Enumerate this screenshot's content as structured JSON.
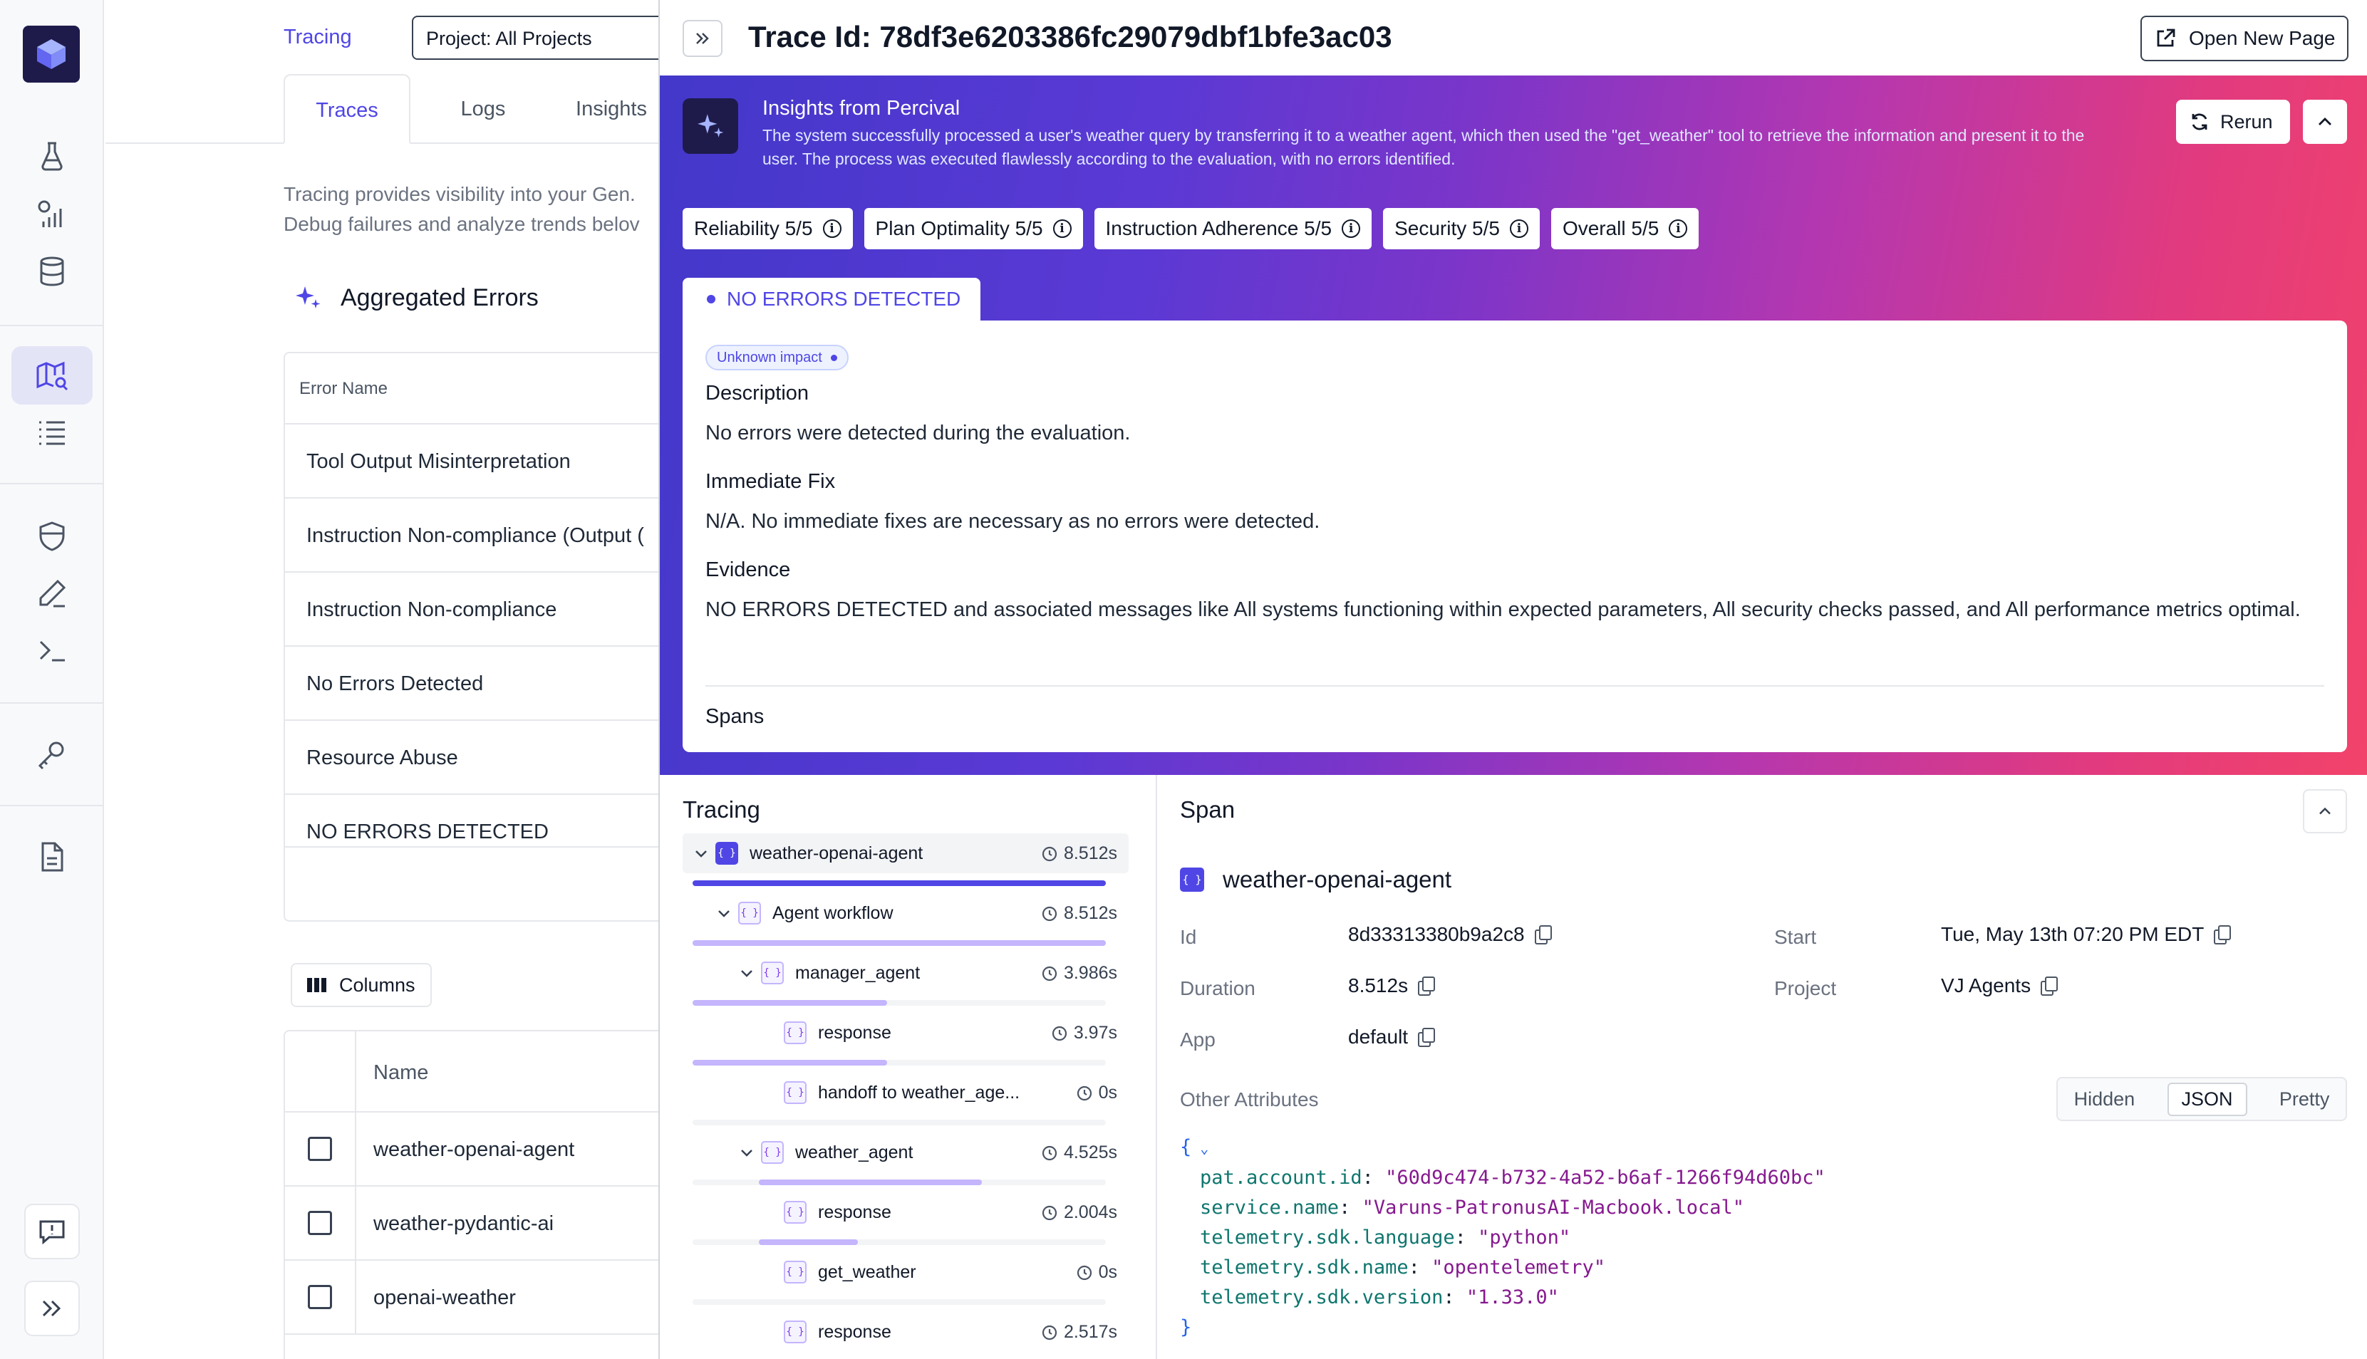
{
  "breadcrumb": {
    "title": "Tracing",
    "project_select": "Project: All Projects"
  },
  "bg_tabs": [
    "Traces",
    "Logs",
    "Insights"
  ],
  "intro_lines": [
    "Tracing provides visibility into your Gen.",
    "Debug failures and analyze trends belov"
  ],
  "aggregated_errors": {
    "title": "Aggregated Errors",
    "column": "Error Name",
    "rows": [
      "Tool Output Misinterpretation",
      "Instruction Non-compliance (Output (",
      "Instruction Non-compliance",
      "No Errors Detected",
      "Resource Abuse",
      "NO ERRORS DETECTED"
    ]
  },
  "columns_button": "Columns",
  "name_table": {
    "column": "Name",
    "rows": [
      "weather-openai-agent",
      "weather-pydantic-ai",
      "openai-weather"
    ]
  },
  "drawer": {
    "title": "Trace Id: 78df3e6203386fc29079dbf1bfe3ac03",
    "open_new_page": "Open New Page"
  },
  "insights": {
    "title": "Insights from Percival",
    "summary": "The system successfully processed a user's weather query by transferring it to a weather agent, which then used the \"get_weather\" tool to retrieve the information and present it to the user. The process was executed flawlessly according to the evaluation, with no errors identified.",
    "rerun": "Rerun",
    "scores": [
      "Reliability 5/5",
      "Plan Optimality 5/5",
      "Instruction Adherence 5/5",
      "Security 5/5",
      "Overall 5/5"
    ],
    "error_tab": "NO ERRORS DETECTED",
    "impact": "Unknown impact",
    "description_h": "Description",
    "description": "No errors were detected during the evaluation.",
    "fix_h": "Immediate Fix",
    "fix": "N/A. No immediate fixes are necessary as no errors were detected.",
    "evidence_h": "Evidence",
    "evidence": "NO ERRORS DETECTED and associated messages like All systems functioning within expected parameters, All security checks passed, and All performance metrics optimal.",
    "spans_h": "Spans"
  },
  "tracing": {
    "title": "Tracing",
    "nodes": [
      {
        "name": "weather-openai-agent",
        "duration": "8.512s",
        "depth": 0,
        "expanded": true,
        "progress_start": 0,
        "progress_end": 1.0
      },
      {
        "name": "Agent workflow",
        "duration": "8.512s",
        "depth": 1,
        "expanded": true,
        "progress_start": 0,
        "progress_end": 1.0
      },
      {
        "name": "manager_agent",
        "duration": "3.986s",
        "depth": 2,
        "expanded": true,
        "progress_start": 0,
        "progress_end": 0.47
      },
      {
        "name": "response",
        "duration": "3.97s",
        "depth": 3,
        "expanded": false,
        "progress_start": 0,
        "progress_end": 0.47
      },
      {
        "name": "handoff to weather_age...",
        "duration": "0s",
        "depth": 3,
        "expanded": false,
        "progress_start": 0.47,
        "progress_end": 0.47
      },
      {
        "name": "weather_agent",
        "duration": "4.525s",
        "depth": 2,
        "expanded": true,
        "progress_start": 0.16,
        "progress_end": 0.7
      },
      {
        "name": "response",
        "duration": "2.004s",
        "depth": 3,
        "expanded": false,
        "progress_start": 0.16,
        "progress_end": 0.4
      },
      {
        "name": "get_weather",
        "duration": "0s",
        "depth": 3,
        "expanded": false,
        "progress_start": 0.4,
        "progress_end": 0.4
      },
      {
        "name": "response",
        "duration": "2.517s",
        "depth": 3,
        "expanded": false,
        "progress_start": 0.4,
        "progress_end": 0.7
      }
    ]
  },
  "span": {
    "title": "Span",
    "name": "weather-openai-agent",
    "id_label": "Id",
    "id": "8d33313380b9a2c8",
    "duration_label": "Duration",
    "duration": "8.512s",
    "app_label": "App",
    "app": "default",
    "start_label": "Start",
    "start": "Tue, May 13th 07:20 PM EDT",
    "project_label": "Project",
    "project": "VJ Agents",
    "other_attributes": "Other Attributes",
    "view_modes": [
      "Hidden",
      "JSON",
      "Pretty"
    ],
    "selected_mode": "JSON",
    "attributes": [
      {
        "key": "pat.account.id",
        "value": "\"60d9c474-b732-4a52-b6af-1266f94d60bc\""
      },
      {
        "key": "service.name",
        "value": "\"Varuns-PatronusAI-Macbook.local\""
      },
      {
        "key": "telemetry.sdk.language",
        "value": "\"python\""
      },
      {
        "key": "telemetry.sdk.name",
        "value": "\"opentelemetry\""
      },
      {
        "key": "telemetry.sdk.version",
        "value": "\"1.33.0\""
      }
    ]
  },
  "colors": {
    "accent": "#4f46e5",
    "brand_dark": "#1e1b4b",
    "gradient_start": "#4338ca",
    "gradient_end": "#f2436a"
  },
  "icons": [
    "logo-cube-icon",
    "flask-icon",
    "chart-icon",
    "database-icon",
    "map-search-icon",
    "list-icon",
    "shield-icon",
    "pencil-icon",
    "terminal-icon",
    "key-icon",
    "document-icon",
    "feedback-icon",
    "expand-icon"
  ]
}
